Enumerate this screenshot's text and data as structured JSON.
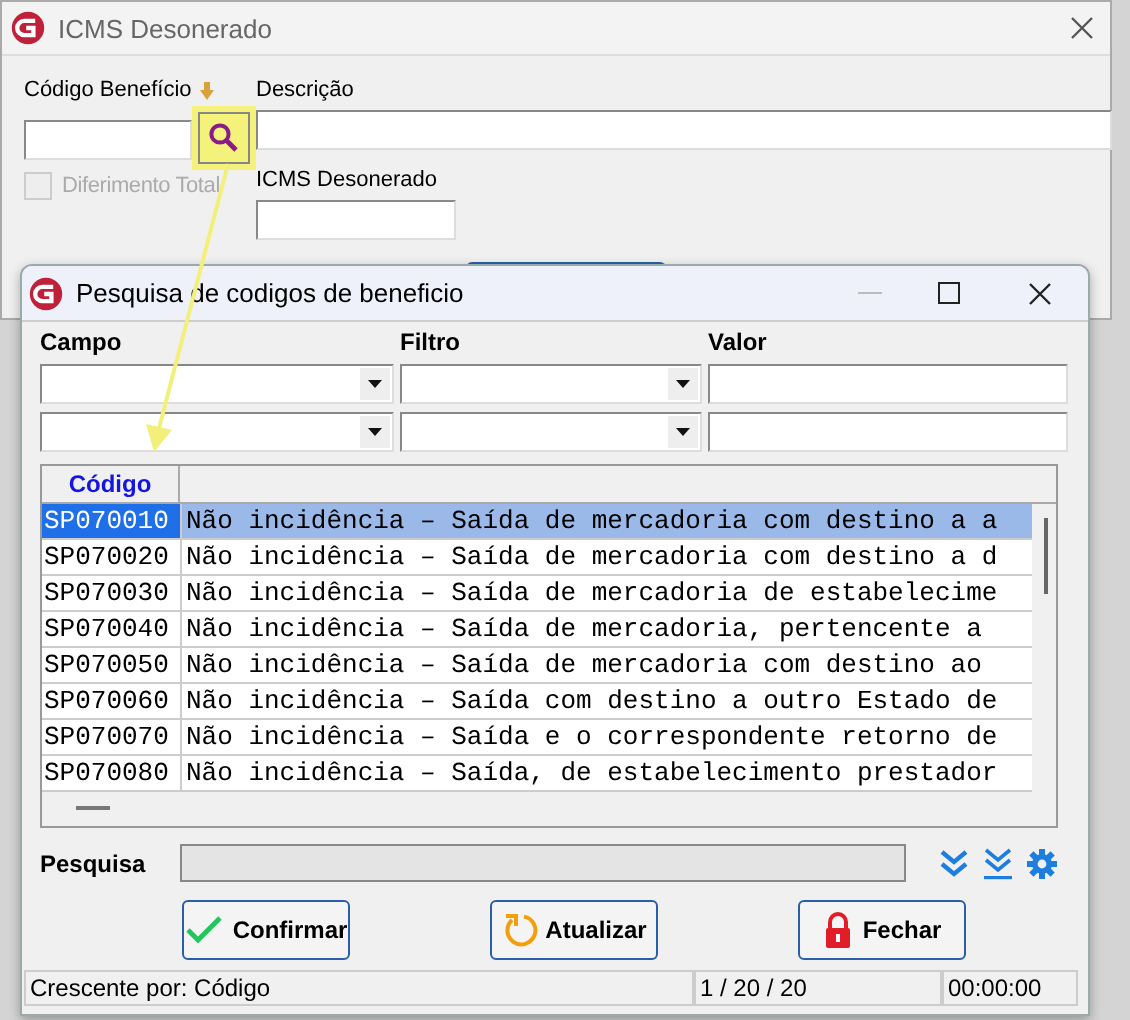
{
  "main_window": {
    "title": "ICMS Desonerado",
    "codigo_label": "Código Benefício",
    "descricao_label": "Descrição",
    "diferimento": {
      "label": "Diferimento Total",
      "checked": false,
      "disabled": true
    },
    "icms_label": "ICMS Desonerado"
  },
  "dialog": {
    "title": "Pesquisa de codigos de beneficio",
    "filter_headers": [
      "Campo",
      "Filtro",
      "Valor"
    ],
    "grid": {
      "columns": [
        "Código"
      ],
      "rows": [
        {
          "code": "SP070010",
          "description": "Não incidência – Saída de mercadoria com destino a a",
          "selected": true
        },
        {
          "code": "SP070020",
          "description": "Não incidência – Saída de mercadoria com destino a d",
          "selected": false
        },
        {
          "code": "SP070030",
          "description": "Não incidência – Saída de mercadoria de estabelecime",
          "selected": false
        },
        {
          "code": "SP070040",
          "description": "Não incidência – Saída de mercadoria, pertencente a",
          "selected": false
        },
        {
          "code": "SP070050",
          "description": "Não incidência – Saída de mercadoria com destino ao",
          "selected": false
        },
        {
          "code": "SP070060",
          "description": "Não incidência – Saída com destino a outro Estado de",
          "selected": false
        },
        {
          "code": "SP070070",
          "description": "Não incidência – Saída e o correspondente retorno de",
          "selected": false
        },
        {
          "code": "SP070080",
          "description": "Não incidência – Saída, de estabelecimento prestador",
          "selected": false
        }
      ]
    },
    "search_label": "Pesquisa",
    "buttons": [
      {
        "label": "Confirmar",
        "kind": "confirm"
      },
      {
        "label": "Atualizar",
        "kind": "refresh"
      },
      {
        "label": "Fechar",
        "kind": "close"
      }
    ],
    "status_bar": [
      "Crescente por: Código",
      "1 / 20 / 20",
      "00:00:00"
    ]
  }
}
